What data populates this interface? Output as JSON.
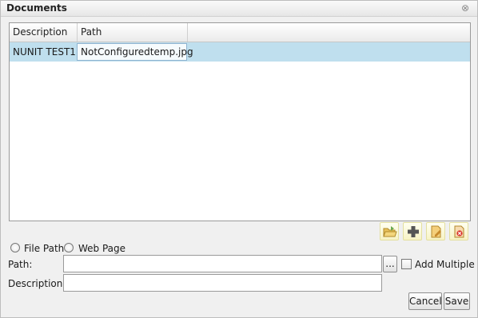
{
  "window": {
    "title": "Documents",
    "close_glyph": "⊗"
  },
  "grid": {
    "columns": [
      "Description",
      "Path"
    ],
    "rows": [
      {
        "description": "NUNIT TEST1",
        "path": "NotConfiguredtemp.jpg",
        "selected": true
      }
    ]
  },
  "toolbar": {
    "icons": [
      "open-folder-icon",
      "add-icon",
      "edit-document-icon",
      "delete-document-icon"
    ]
  },
  "source": {
    "file_path_label": "File Path",
    "web_page_label": "Web Page"
  },
  "form": {
    "path_label": "Path:",
    "path_value": "",
    "browse_label": "...",
    "add_multiple_label": "Add Multiple",
    "description_label": "Description:",
    "description_value": ""
  },
  "actions": {
    "cancel_label": "Cancel",
    "save_label": "Save"
  }
}
